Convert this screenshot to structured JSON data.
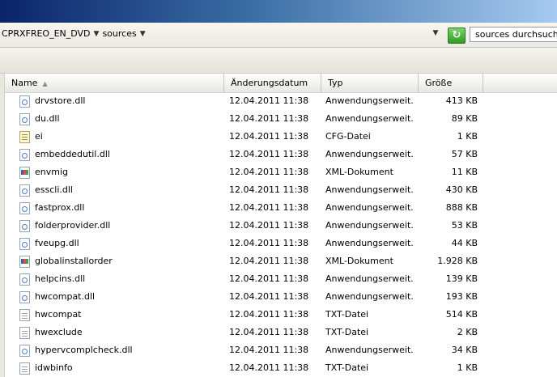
{
  "address": {
    "crumbs": [
      "CPRXFREO_EN_DVD",
      "sources"
    ],
    "search_placeholder": "sources durchsuchen"
  },
  "columns": {
    "name": "Name",
    "date": "Änderungsdatum",
    "type": "Typ",
    "size": "Größe"
  },
  "files": [
    {
      "name": "drvstore.dll",
      "date": "12.04.2011 11:38",
      "type": "Anwendungserweit...",
      "size": "413 KB",
      "icon": "dll-file-icon"
    },
    {
      "name": "du.dll",
      "date": "12.04.2011 11:38",
      "type": "Anwendungserweit...",
      "size": "89 KB",
      "icon": "dll-file-icon"
    },
    {
      "name": "ei",
      "date": "12.04.2011 11:38",
      "type": "CFG-Datei",
      "size": "1 KB",
      "icon": "cfg-file-icon"
    },
    {
      "name": "embeddedutil.dll",
      "date": "12.04.2011 11:38",
      "type": "Anwendungserweit...",
      "size": "57 KB",
      "icon": "dll-file-icon"
    },
    {
      "name": "envmig",
      "date": "12.04.2011 11:38",
      "type": "XML-Dokument",
      "size": "11 KB",
      "icon": "xml-file-icon"
    },
    {
      "name": "esscli.dll",
      "date": "12.04.2011 11:38",
      "type": "Anwendungserweit...",
      "size": "430 KB",
      "icon": "dll-file-icon"
    },
    {
      "name": "fastprox.dll",
      "date": "12.04.2011 11:38",
      "type": "Anwendungserweit...",
      "size": "888 KB",
      "icon": "dll-file-icon"
    },
    {
      "name": "folderprovider.dll",
      "date": "12.04.2011 11:38",
      "type": "Anwendungserweit...",
      "size": "53 KB",
      "icon": "dll-file-icon"
    },
    {
      "name": "fveupg.dll",
      "date": "12.04.2011 11:38",
      "type": "Anwendungserweit...",
      "size": "44 KB",
      "icon": "dll-file-icon"
    },
    {
      "name": "globalinstallorder",
      "date": "12.04.2011 11:38",
      "type": "XML-Dokument",
      "size": "1.928 KB",
      "icon": "xml-file-icon"
    },
    {
      "name": "helpcins.dll",
      "date": "12.04.2011 11:38",
      "type": "Anwendungserweit...",
      "size": "139 KB",
      "icon": "dll-file-icon"
    },
    {
      "name": "hwcompat.dll",
      "date": "12.04.2011 11:38",
      "type": "Anwendungserweit...",
      "size": "193 KB",
      "icon": "dll-file-icon"
    },
    {
      "name": "hwcompat",
      "date": "12.04.2011 11:38",
      "type": "TXT-Datei",
      "size": "514 KB",
      "icon": "txt-file-icon"
    },
    {
      "name": "hwexclude",
      "date": "12.04.2011 11:38",
      "type": "TXT-Datei",
      "size": "2 KB",
      "icon": "txt-file-icon"
    },
    {
      "name": "hypervcomplcheck.dll",
      "date": "12.04.2011 11:38",
      "type": "Anwendungserweit...",
      "size": "34 KB",
      "icon": "dll-file-icon"
    },
    {
      "name": "idwbinfo",
      "date": "12.04.2011 11:38",
      "type": "TXT-Datei",
      "size": "1 KB",
      "icon": "txt-file-icon"
    }
  ]
}
